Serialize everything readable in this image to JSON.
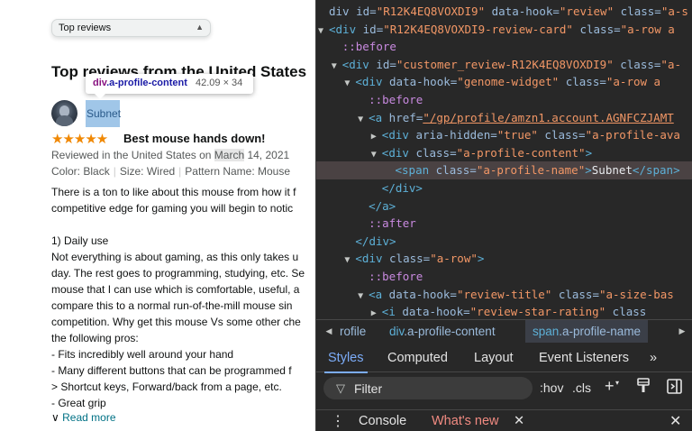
{
  "page": {
    "sort_label": "Top reviews",
    "heading": "Top reviews from the United States",
    "tooltip": {
      "tag": "div",
      "cls": ".a-profile-content",
      "size": "42.09 × 34"
    },
    "profile_name": "Subnet",
    "rating": 5,
    "stars": "★★★★★",
    "review_title": "Best mouse hands down!",
    "review_meta": {
      "prefix": "Reviewed in the United States on ",
      "highlight": "March",
      "suffix": " 14, 2021"
    },
    "variant": {
      "color": "Color: Black",
      "size": "Size: Wired",
      "pattern": "Pattern Name: Mouse"
    },
    "body_lines": [
      "There is a ton to like about this mouse from how it f",
      "competitive edge for gaming you will begin to notic",
      "",
      "1) Daily use",
      "Not everything is about gaming, as this only takes u",
      "day. The rest goes to programming, studying, etc. Se",
      "mouse that I can use which is comfortable, useful, a",
      "compare this to a normal run-of-the-mill mouse sin",
      "competition. Why get this mouse Vs some other che",
      "the following pros:",
      "- Fits incredibly well around your hand",
      "- Many different buttons that can be programmed f",
      "> Shortcut keys, Forward/back from a page, etc.",
      "- Great grip"
    ],
    "read_more": "Read more"
  },
  "devtools": {
    "dom": [
      {
        "indent": 0,
        "parts": [
          [
            "t-attr",
            "div id="
          ],
          [
            "t-val",
            "\"R12K4EQ8VOXDI9\""
          ],
          [
            "t-attr",
            " data-hook="
          ],
          [
            "t-val",
            "\"review\""
          ],
          [
            "t-attr",
            " class="
          ],
          [
            "t-val",
            "\"a-s"
          ]
        ]
      },
      {
        "indent": 0,
        "tri": "▼",
        "parts": [
          [
            "t-tag",
            "<div "
          ],
          [
            "t-attr",
            "id="
          ],
          [
            "t-val",
            "\"R12K4EQ8VOXDI9-review-card\""
          ],
          [
            "t-attr",
            " class="
          ],
          [
            "t-val",
            "\"a-row a"
          ]
        ]
      },
      {
        "indent": 1,
        "parts": [
          [
            "t-pseudo",
            "::before"
          ]
        ]
      },
      {
        "indent": 1,
        "tri": "▼",
        "parts": [
          [
            "t-tag",
            "<div "
          ],
          [
            "t-attr",
            "id="
          ],
          [
            "t-val",
            "\"customer_review-R12K4EQ8VOXDI9\""
          ],
          [
            "t-attr",
            " class="
          ],
          [
            "t-val",
            "\"a-"
          ]
        ]
      },
      {
        "indent": 2,
        "tri": "▼",
        "parts": [
          [
            "t-tag",
            "<div "
          ],
          [
            "t-attr",
            "data-hook="
          ],
          [
            "t-val",
            "\"genome-widget\""
          ],
          [
            "t-attr",
            " class="
          ],
          [
            "t-val",
            "\"a-row a"
          ]
        ]
      },
      {
        "indent": 3,
        "parts": [
          [
            "t-pseudo",
            "::before"
          ]
        ]
      },
      {
        "indent": 3,
        "tri": "▼",
        "parts": [
          [
            "t-tag",
            "<a "
          ],
          [
            "t-attr",
            "href="
          ],
          [
            "t-link",
            "\"/gp/profile/amzn1.account.AGNFCZJAMT"
          ]
        ]
      },
      {
        "indent": 4,
        "tri": "▶",
        "parts": [
          [
            "t-tag",
            "<div "
          ],
          [
            "t-attr",
            "aria-hidden="
          ],
          [
            "t-val",
            "\"true\""
          ],
          [
            "t-attr",
            " class="
          ],
          [
            "t-val",
            "\"a-profile-ava"
          ]
        ]
      },
      {
        "indent": 4,
        "tri": "▼",
        "parts": [
          [
            "t-tag",
            "<div "
          ],
          [
            "t-attr",
            "class="
          ],
          [
            "t-val",
            "\"a-profile-content\""
          ],
          [
            "t-tag",
            ">"
          ]
        ]
      },
      {
        "indent": 5,
        "selected": true,
        "parts": [
          [
            "t-tag",
            "<span "
          ],
          [
            "t-attr",
            "class="
          ],
          [
            "t-val",
            "\"a-profile-name\""
          ],
          [
            "t-tag",
            ">"
          ],
          [
            "t-text",
            "Subnet"
          ],
          [
            "t-tag",
            "</span>"
          ]
        ]
      },
      {
        "indent": 4,
        "parts": [
          [
            "t-tag",
            "</div>"
          ]
        ]
      },
      {
        "indent": 3,
        "parts": [
          [
            "t-tag",
            "</a>"
          ]
        ]
      },
      {
        "indent": 3,
        "parts": [
          [
            "t-pseudo",
            "::after"
          ]
        ]
      },
      {
        "indent": 2,
        "parts": [
          [
            "t-tag",
            "</div>"
          ]
        ]
      },
      {
        "indent": 2,
        "tri": "▼",
        "parts": [
          [
            "t-tag",
            "<div "
          ],
          [
            "t-attr",
            "class="
          ],
          [
            "t-val",
            "\"a-row\""
          ],
          [
            "t-tag",
            ">"
          ]
        ]
      },
      {
        "indent": 3,
        "parts": [
          [
            "t-pseudo",
            "::before"
          ]
        ]
      },
      {
        "indent": 3,
        "tri": "▼",
        "parts": [
          [
            "t-tag",
            "<a "
          ],
          [
            "t-attr",
            "data-hook="
          ],
          [
            "t-val",
            "\"review-title\""
          ],
          [
            "t-attr",
            " class="
          ],
          [
            "t-val",
            "\"a-size-bas"
          ]
        ]
      },
      {
        "indent": 4,
        "tri": "▶",
        "parts": [
          [
            "t-tag",
            "<i "
          ],
          [
            "t-attr",
            "data-hook="
          ],
          [
            "t-val",
            "\"review-star-rating\""
          ],
          [
            "t-attr",
            " class"
          ]
        ]
      }
    ],
    "breadcrumbs": {
      "left_arrow": "◀",
      "right_arrow": "▶",
      "items": [
        {
          "tag": "",
          "cls": "rofile"
        },
        {
          "tag": "div",
          "cls": ".a-profile-content"
        },
        {
          "tag": "span",
          "cls": ".a-profile-name"
        }
      ]
    },
    "tabs": [
      "Styles",
      "Computed",
      "Layout",
      "Event Listeners"
    ],
    "tabs_more": "»",
    "active_tab": "Styles",
    "filter_placeholder": "Filter",
    "hov_label": ":hov",
    "cls_label": ".cls",
    "drawer": {
      "menu": "⋮",
      "console": "Console",
      "whats_new": "What's new",
      "close_tab": "✕",
      "close": "✕"
    }
  }
}
